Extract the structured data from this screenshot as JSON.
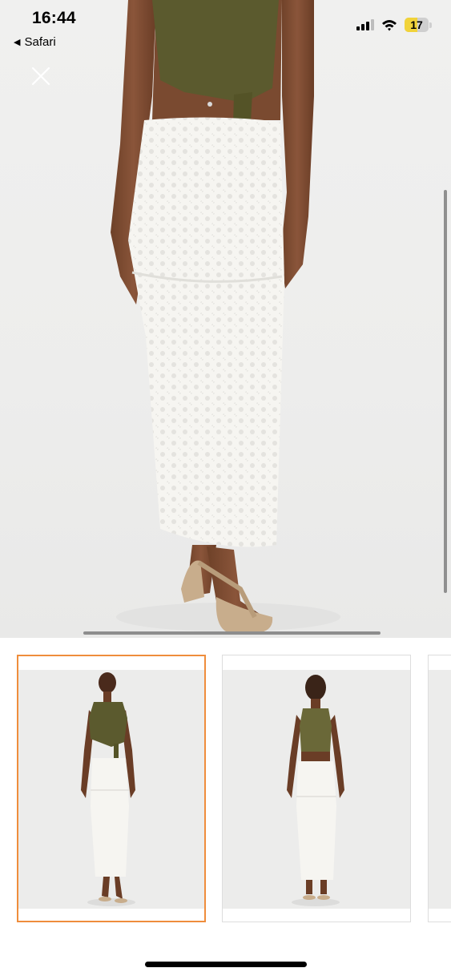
{
  "status_bar": {
    "time": "16:44",
    "back_label": "Safari",
    "battery_level": "17",
    "icons": [
      "cellular-signal-icon",
      "wifi-icon",
      "battery-icon"
    ]
  },
  "viewer": {
    "close_icon": "close-icon",
    "selected_thumbnail": 1,
    "thumbnail_count_visible": 3
  },
  "colors": {
    "selected_border": "#ef8d3c",
    "top": "#5b5a2e",
    "skirt": "#f7f6f2",
    "sandal": "#c8ad8c"
  }
}
